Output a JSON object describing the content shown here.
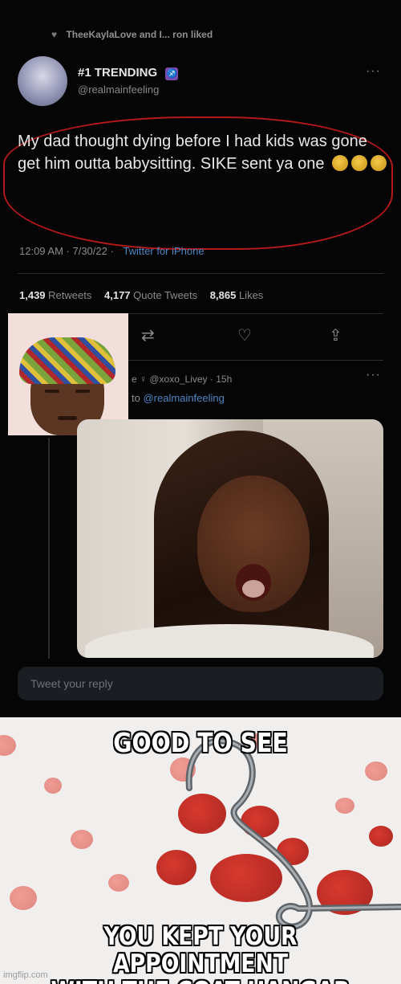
{
  "tweet": {
    "liked_by": "TheeKaylaLove and I... ron liked",
    "display_name": "#1 TRENDING",
    "handle": "@realmainfeeling",
    "text": "My dad thought dying before I had kids was gone get him outta babysitting. SIKE sent ya one",
    "timestamp": "12:09 AM · 7/30/22 ·",
    "source": "Twitter for iPhone",
    "stats": {
      "retweets_count": "1,439",
      "retweets_label": "Retweets",
      "quotes_count": "4,177",
      "quotes_label": "Quote Tweets",
      "likes_count": "8,865",
      "likes_label": "Likes"
    },
    "reply": {
      "handle_line": "e ♀ @xoxo_Livey · 15h",
      "replying_prefix": "to",
      "replying_to": "@realmainfeeling"
    },
    "reply_placeholder": "Tweet your reply"
  },
  "meme": {
    "top_text": "GOOD TO SEE",
    "bottom_text_line1": "YOU KEPT YOUR APPOINTMENT",
    "bottom_text_line2": "WITH THE COAT HANGAR",
    "watermark": "imgflip.com"
  },
  "colors": {
    "highlight": "#b51919",
    "link": "#4d86c4",
    "blood": "#c0170f"
  }
}
